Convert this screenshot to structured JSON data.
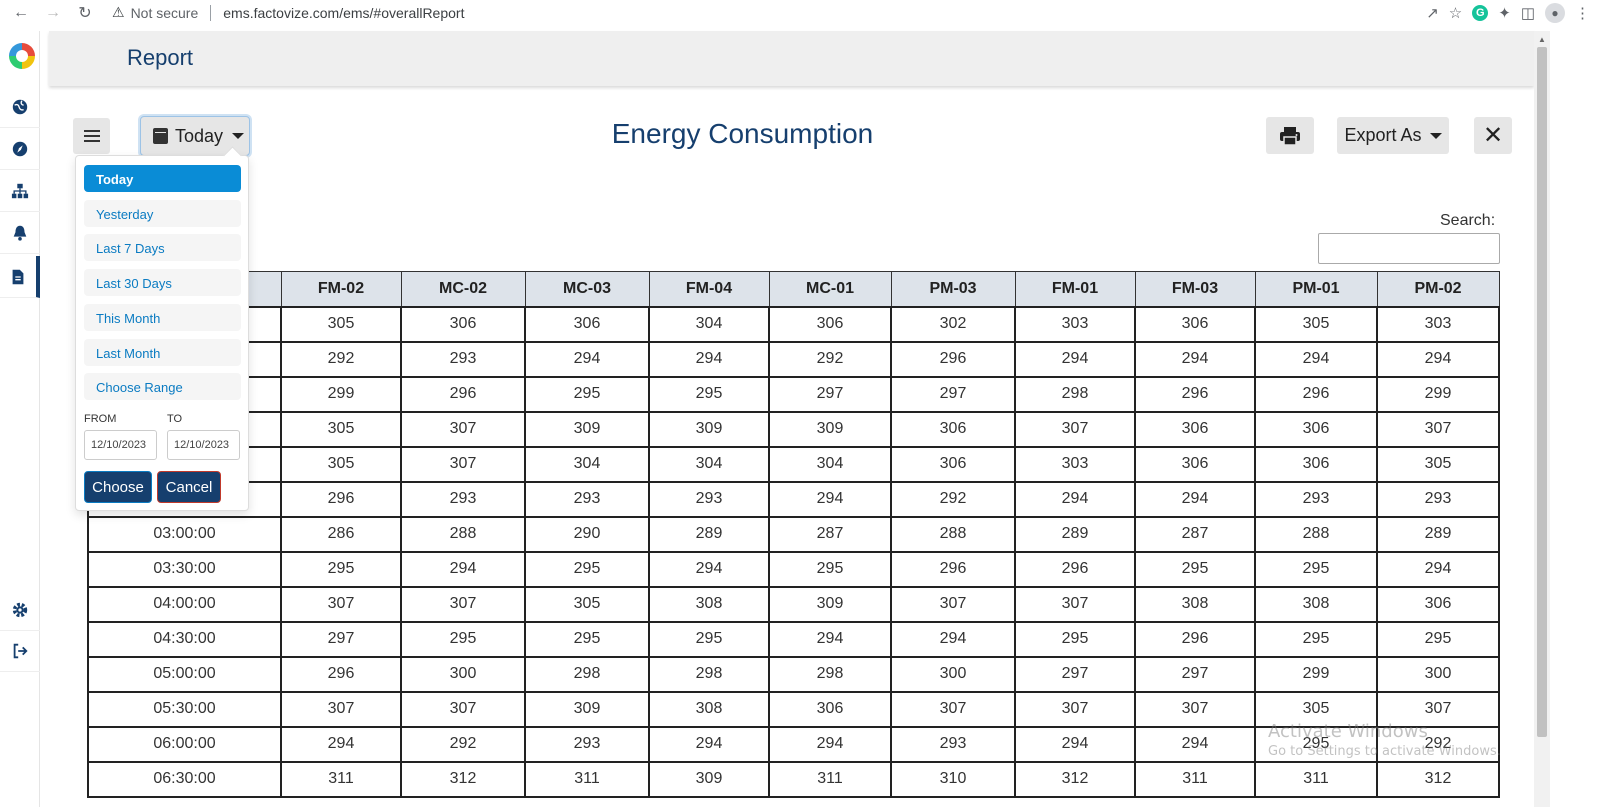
{
  "browser": {
    "security": "Not secure",
    "url": "ems.factovize.com/ems/#overallReport"
  },
  "header": {
    "title": "Report"
  },
  "toolbar": {
    "range_label": "Today",
    "heading": "Energy Consumption",
    "export_label": "Export As",
    "search_label": "Search:",
    "search_value": ""
  },
  "sidebar": {
    "icons": [
      "globe-icon",
      "compass-icon",
      "sitemap-icon",
      "bell-icon",
      "report-icon",
      "gear-icon",
      "sign-out-icon"
    ]
  },
  "dropdown": {
    "ranges": [
      "Today",
      "Yesterday",
      "Last 7 Days",
      "Last 30 Days",
      "This Month",
      "Last Month",
      "Choose Range"
    ],
    "from_label": "FROM",
    "to_label": "TO",
    "from_value": "12/10/2023",
    "to_value": "12/10/2023",
    "choose_label": "Choose",
    "cancel_label": "Cancel"
  },
  "table": {
    "columns": [
      "",
      "FM-02",
      "MC-02",
      "MC-03",
      "FM-04",
      "MC-01",
      "PM-03",
      "FM-01",
      "FM-03",
      "PM-01",
      "PM-02"
    ],
    "rows": [
      [
        "",
        "305",
        "306",
        "306",
        "304",
        "306",
        "302",
        "303",
        "306",
        "305",
        "303"
      ],
      [
        "",
        "292",
        "293",
        "294",
        "294",
        "292",
        "296",
        "294",
        "294",
        "294",
        "294"
      ],
      [
        "",
        "299",
        "296",
        "295",
        "295",
        "297",
        "297",
        "298",
        "296",
        "296",
        "299"
      ],
      [
        "",
        "305",
        "307",
        "309",
        "309",
        "309",
        "306",
        "307",
        "306",
        "306",
        "307"
      ],
      [
        "",
        "305",
        "307",
        "304",
        "304",
        "304",
        "306",
        "303",
        "306",
        "306",
        "305"
      ],
      [
        "",
        "296",
        "293",
        "293",
        "293",
        "294",
        "292",
        "294",
        "294",
        "293",
        "293"
      ],
      [
        "03:00:00",
        "286",
        "288",
        "290",
        "289",
        "287",
        "288",
        "289",
        "287",
        "288",
        "289"
      ],
      [
        "03:30:00",
        "295",
        "294",
        "295",
        "294",
        "295",
        "296",
        "296",
        "295",
        "295",
        "294"
      ],
      [
        "04:00:00",
        "307",
        "307",
        "305",
        "308",
        "309",
        "307",
        "307",
        "308",
        "308",
        "306"
      ],
      [
        "04:30:00",
        "297",
        "295",
        "295",
        "295",
        "294",
        "294",
        "295",
        "296",
        "295",
        "295"
      ],
      [
        "05:00:00",
        "296",
        "300",
        "298",
        "298",
        "298",
        "300",
        "297",
        "297",
        "299",
        "300"
      ],
      [
        "05:30:00",
        "307",
        "307",
        "309",
        "308",
        "306",
        "307",
        "307",
        "307",
        "305",
        "307"
      ],
      [
        "06:00:00",
        "294",
        "292",
        "293",
        "294",
        "294",
        "293",
        "294",
        "294",
        "295",
        "292"
      ],
      [
        "06:30:00",
        "311",
        "312",
        "311",
        "309",
        "311",
        "310",
        "312",
        "311",
        "311",
        "312"
      ]
    ]
  },
  "watermark": {
    "line1": "Activate Windows",
    "line2": "Go to Settings to activate Windows."
  }
}
